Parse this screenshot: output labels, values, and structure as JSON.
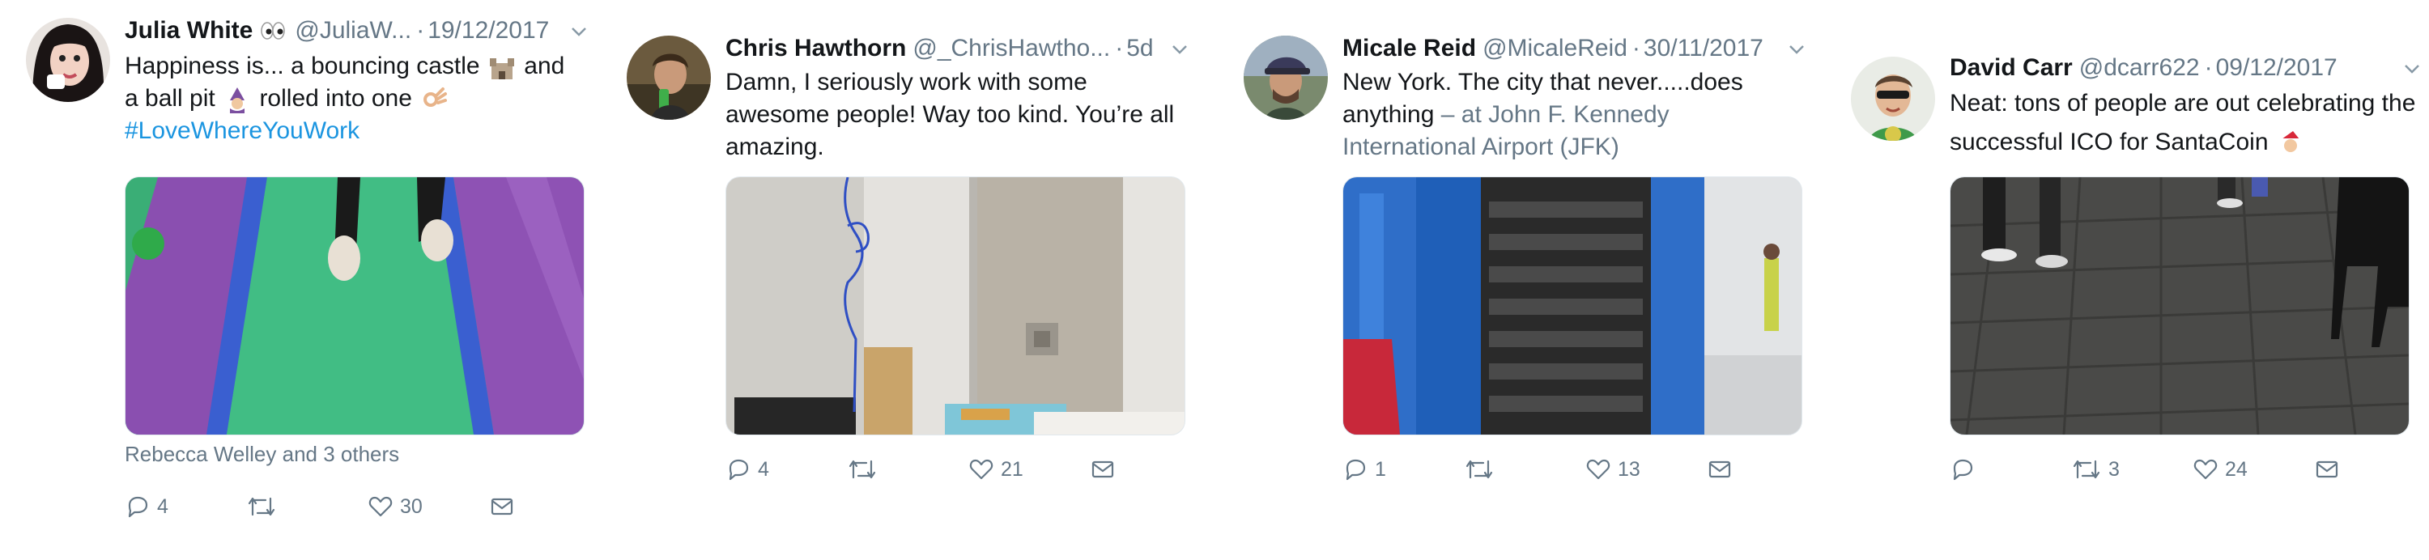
{
  "tweets": [
    {
      "name": "Julia White",
      "name_emoji": "eyes-emoji",
      "handle": "@JuliaW...",
      "dot": "·",
      "time": "19/12/2017",
      "text_line1a": "Happiness is... a bouncing castle",
      "text_line1b": "and",
      "text_line2a": "a ball pit",
      "text_line2b": "rolled into one",
      "hashtag": "#LoveWhereYouWork",
      "social_context": "Rebecca Welley and 3 others",
      "replies": "4",
      "retweets": "",
      "likes": "30"
    },
    {
      "name": "Chris Hawthorn",
      "handle": "@_ChrisHawtho...",
      "dot": "·",
      "time": "5d",
      "text": "Damn, I seriously work with some awesome people! Way too kind. You’re all amazing.",
      "replies": "4",
      "retweets": "",
      "likes": "21"
    },
    {
      "name": "Micale Reid",
      "handle": "@MicaleReid",
      "dot": "·",
      "time": "30/11/2017",
      "text": "New York. The city that never.....does anything",
      "place": "– at John F. Kennedy International Airport (JFK)",
      "replies": "1",
      "retweets": "",
      "likes": "13"
    },
    {
      "name": "David Carr",
      "handle": "@dcarr622",
      "dot": "·",
      "time": "09/12/2017",
      "text": "Neat: tons of people are out celebrating the successful ICO for SantaCoin",
      "replies": "",
      "retweets": "3",
      "likes": "24"
    }
  ],
  "icons": {
    "reply": "reply-icon",
    "retweet": "retweet-icon",
    "like": "heart-icon",
    "dm": "envelope-icon",
    "caret": "chevron-down-icon"
  },
  "colors": {
    "text": "#14171a",
    "secondary": "#657786",
    "link": "#1b95e0",
    "border": "#e1e8ed"
  }
}
